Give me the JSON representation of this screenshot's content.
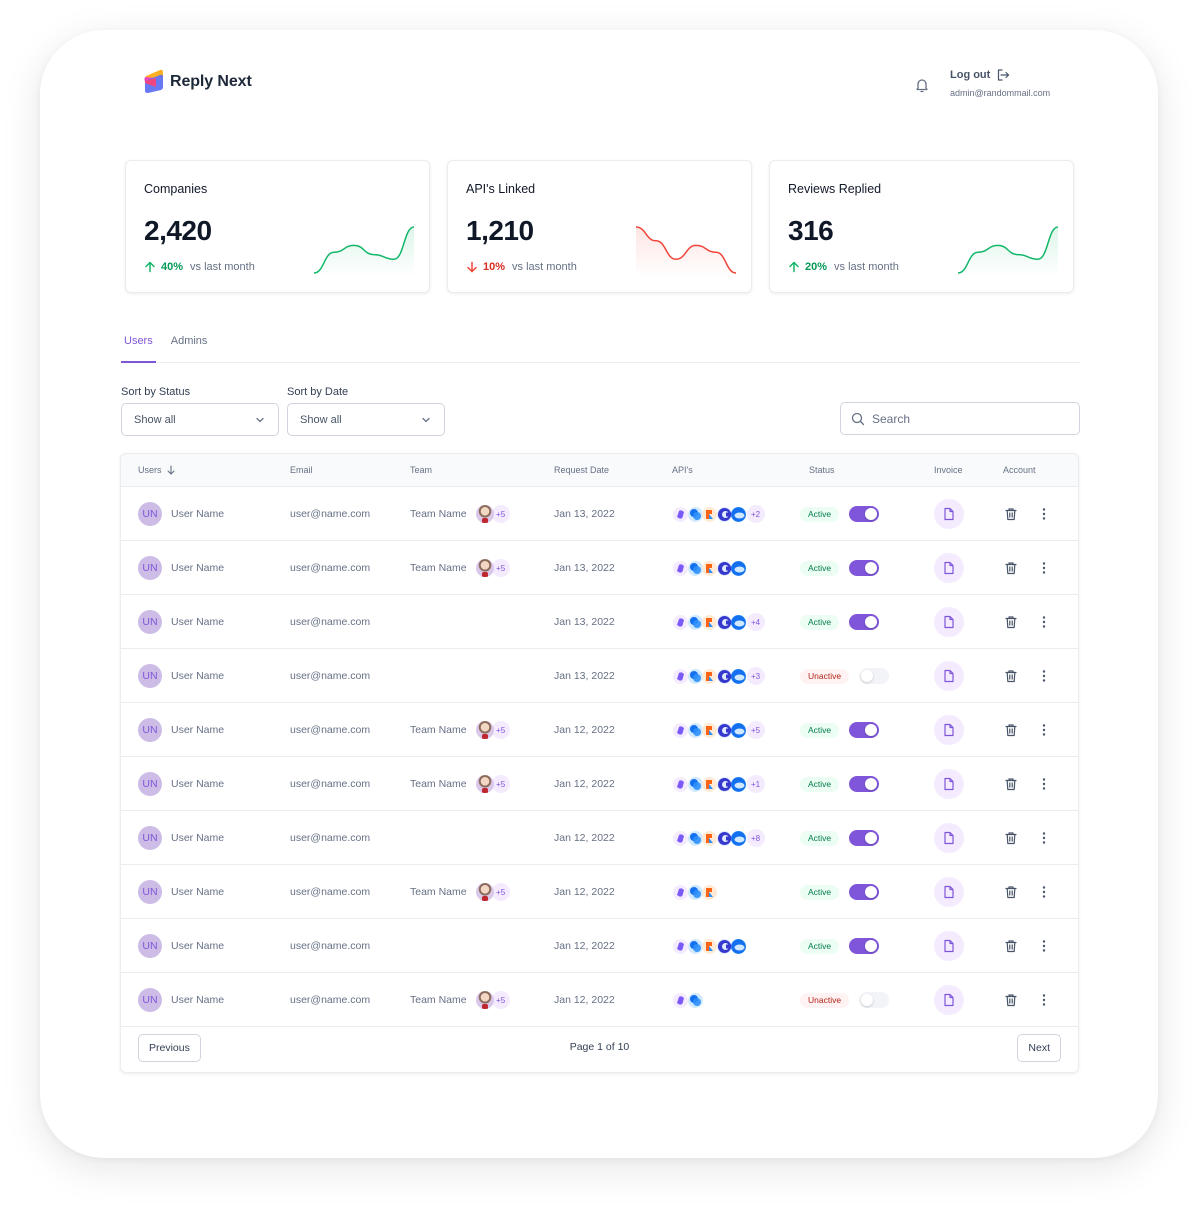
{
  "app": {
    "name": "Reply Next",
    "logout_label": "Log out",
    "admin_email": "admin@randommail.com",
    "icons": {
      "logo": "reply-next-logo",
      "bell": "bell-icon",
      "logout": "logout-icon"
    }
  },
  "stats": [
    {
      "title": "Companies",
      "value": "2,420",
      "delta": "40%",
      "direction": "up",
      "vs": "vs last month",
      "color": "#12b76a",
      "trend": [
        0,
        0.45,
        0.6,
        0.4,
        0.3,
        1.0
      ]
    },
    {
      "title": "API's Linked",
      "value": "1,210",
      "delta": "10%",
      "direction": "down",
      "vs": "vs last month",
      "color": "#f04438",
      "trend": [
        1.0,
        0.7,
        0.3,
        0.6,
        0.45,
        0.0
      ]
    },
    {
      "title": "Reviews Replied",
      "value": "316",
      "delta": "20%",
      "direction": "up",
      "vs": "vs last month",
      "color": "#12b76a",
      "trend": [
        0,
        0.45,
        0.6,
        0.4,
        0.3,
        1.0
      ]
    }
  ],
  "tabs": [
    {
      "label": "Users",
      "active": true
    },
    {
      "label": "Admins",
      "active": false
    }
  ],
  "filters": {
    "status": {
      "label": "Sort by Status",
      "value": "Show all"
    },
    "date": {
      "label": "Sort by Date",
      "value": "Show all"
    },
    "search_placeholder": "Search"
  },
  "table": {
    "columns": [
      "Users",
      "Email",
      "Team",
      "Request Date",
      "API's",
      "Status",
      "Invoice",
      "Account"
    ],
    "rows": [
      {
        "initials": "UN",
        "name": "User Name",
        "email": "user@name.com",
        "team": "Team Name",
        "team_more": "+5",
        "date": "Jan 13, 2022",
        "apis": 5,
        "api_more": "+2",
        "status": "Active",
        "enabled": true
      },
      {
        "initials": "UN",
        "name": "User Name",
        "email": "user@name.com",
        "team": "Team Name",
        "team_more": "+5",
        "date": "Jan 13, 2022",
        "apis": 5,
        "api_more": "",
        "status": "Active",
        "enabled": true
      },
      {
        "initials": "UN",
        "name": "User Name",
        "email": "user@name.com",
        "team": "",
        "team_more": "",
        "date": "Jan 13, 2022",
        "apis": 5,
        "api_more": "+4",
        "status": "Active",
        "enabled": true
      },
      {
        "initials": "UN",
        "name": "User Name",
        "email": "user@name.com",
        "team": "",
        "team_more": "",
        "date": "Jan 13, 2022",
        "apis": 5,
        "api_more": "+3",
        "status": "Unactive",
        "enabled": false
      },
      {
        "initials": "UN",
        "name": "User Name",
        "email": "user@name.com",
        "team": "Team Name",
        "team_more": "+5",
        "date": "Jan 12, 2022",
        "apis": 5,
        "api_more": "+5",
        "status": "Active",
        "enabled": true
      },
      {
        "initials": "UN",
        "name": "User Name",
        "email": "user@name.com",
        "team": "Team Name",
        "team_more": "+5",
        "date": "Jan 12, 2022",
        "apis": 5,
        "api_more": "+1",
        "status": "Active",
        "enabled": true
      },
      {
        "initials": "UN",
        "name": "User Name",
        "email": "user@name.com",
        "team": "",
        "team_more": "",
        "date": "Jan 12, 2022",
        "apis": 5,
        "api_more": "+8",
        "status": "Active",
        "enabled": true
      },
      {
        "initials": "UN",
        "name": "User Name",
        "email": "user@name.com",
        "team": "Team Name",
        "team_more": "+5",
        "date": "Jan 12, 2022",
        "apis": 3,
        "api_more": "",
        "status": "Active",
        "enabled": true
      },
      {
        "initials": "UN",
        "name": "User Name",
        "email": "user@name.com",
        "team": "",
        "team_more": "",
        "date": "Jan 12, 2022",
        "apis": 5,
        "api_more": "",
        "status": "Active",
        "enabled": true
      },
      {
        "initials": "UN",
        "name": "User Name",
        "email": "user@name.com",
        "team": "Team Name",
        "team_more": "+5",
        "date": "Jan 12, 2022",
        "apis": 2,
        "api_more": "",
        "status": "Unactive",
        "enabled": false
      }
    ],
    "api_icons": [
      "purple-cube-icon",
      "blue-circles-icon",
      "orange-r-icon",
      "blue-c-icon",
      "blue-cloud-icon"
    ]
  },
  "pagination": {
    "previous": "Previous",
    "page_text": "Page 1 of 10",
    "next": "Next"
  },
  "colors": {
    "accent": "#7f56d9",
    "success": "#12b76a",
    "danger": "#f04438"
  }
}
